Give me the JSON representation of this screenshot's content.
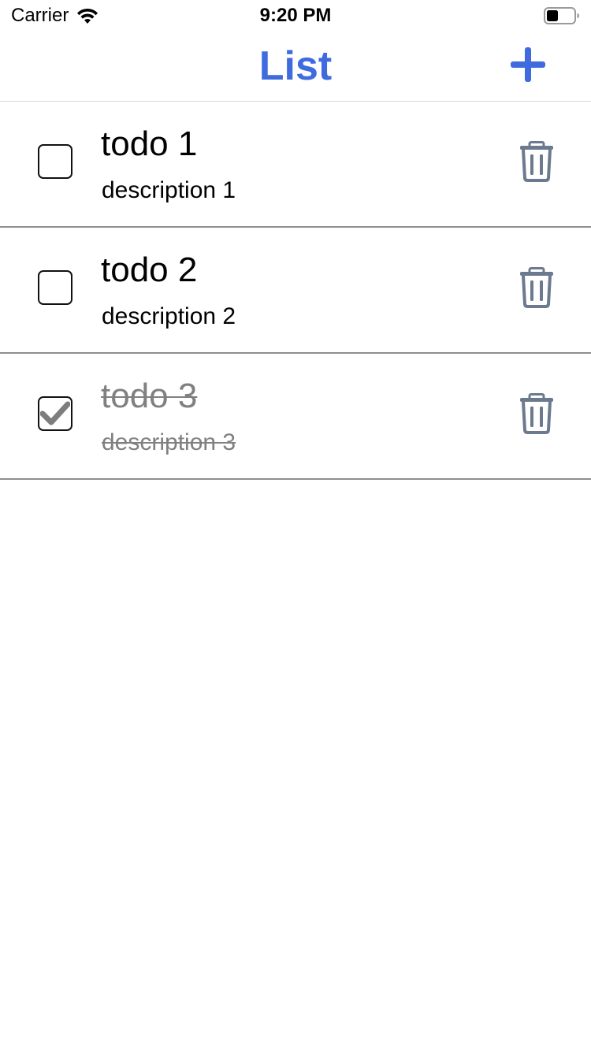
{
  "status_bar": {
    "carrier": "Carrier",
    "time": "9:20 PM",
    "wifi_icon": "wifi-icon",
    "battery_icon": "battery-icon"
  },
  "nav": {
    "title": "List",
    "add_icon": "plus-icon"
  },
  "colors": {
    "accent": "#3f6bde",
    "trash": "#6b7a8f",
    "done_text": "#808080"
  },
  "todos": [
    {
      "title": "todo 1",
      "description": "description 1",
      "completed": false
    },
    {
      "title": "todo 2",
      "description": "description 2",
      "completed": false
    },
    {
      "title": "todo 3",
      "description": "description 3",
      "completed": true
    }
  ]
}
